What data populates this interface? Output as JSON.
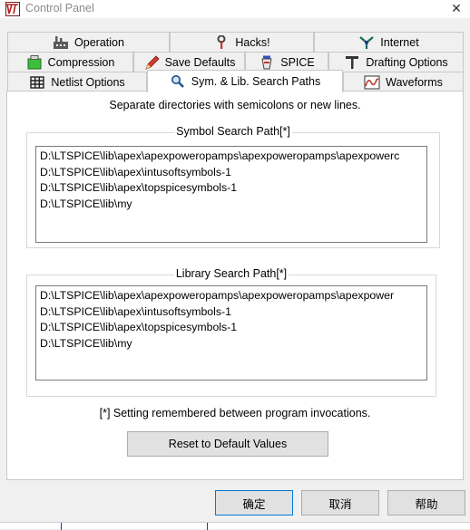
{
  "window": {
    "title": "Control Panel",
    "close_glyph": "✕"
  },
  "tabs": {
    "row1": [
      {
        "label": "Operation",
        "icon": "factory-icon"
      },
      {
        "label": "Hacks!",
        "icon": "wrench-icon"
      },
      {
        "label": "Internet",
        "icon": "network-icon"
      }
    ],
    "row2": [
      {
        "label": "Compression",
        "icon": "compress-icon"
      },
      {
        "label": "Save Defaults",
        "icon": "pencil-icon"
      },
      {
        "label": "SPICE",
        "icon": "spice-icon"
      },
      {
        "label": "Drafting Options",
        "icon": "drafting-icon"
      }
    ],
    "row3": [
      {
        "label": "Netlist Options",
        "icon": "netlist-grid-icon"
      },
      {
        "label": "Sym. & Lib. Search Paths",
        "icon": "magnifier-icon",
        "selected": true
      },
      {
        "label": "Waveforms",
        "icon": "waveform-icon"
      }
    ]
  },
  "panel": {
    "hint": "Separate directories with semicolons or new lines.",
    "symbol_group_label": "Symbol Search Path[*]",
    "symbol_paths": [
      "D:\\LTSPICE\\lib\\apex\\apexpoweropamps\\apexpoweropamps\\apexpowerc",
      "D:\\LTSPICE\\lib\\apex\\intusoftsymbols-1",
      "D:\\LTSPICE\\lib\\apex\\topspicesymbols-1",
      "D:\\LTSPICE\\lib\\my"
    ],
    "library_group_label": "Library Search Path[*]",
    "library_paths": [
      "D:\\LTSPICE\\lib\\apex\\apexpoweropamps\\apexpoweropamps\\apexpower",
      "D:\\LTSPICE\\lib\\apex\\intusoftsymbols-1",
      "D:\\LTSPICE\\lib\\apex\\topspicesymbols-1",
      "D:\\LTSPICE\\lib\\my"
    ],
    "note": "[*] Setting remembered between program invocations.",
    "reset_label": "Reset to Default Values"
  },
  "buttons": {
    "ok": "确定",
    "cancel": "取消",
    "help": "帮助"
  },
  "colors": {
    "accent": "#0078d7",
    "panel_bg": "#ffffff",
    "dialog_bg": "#f0f0f0"
  }
}
